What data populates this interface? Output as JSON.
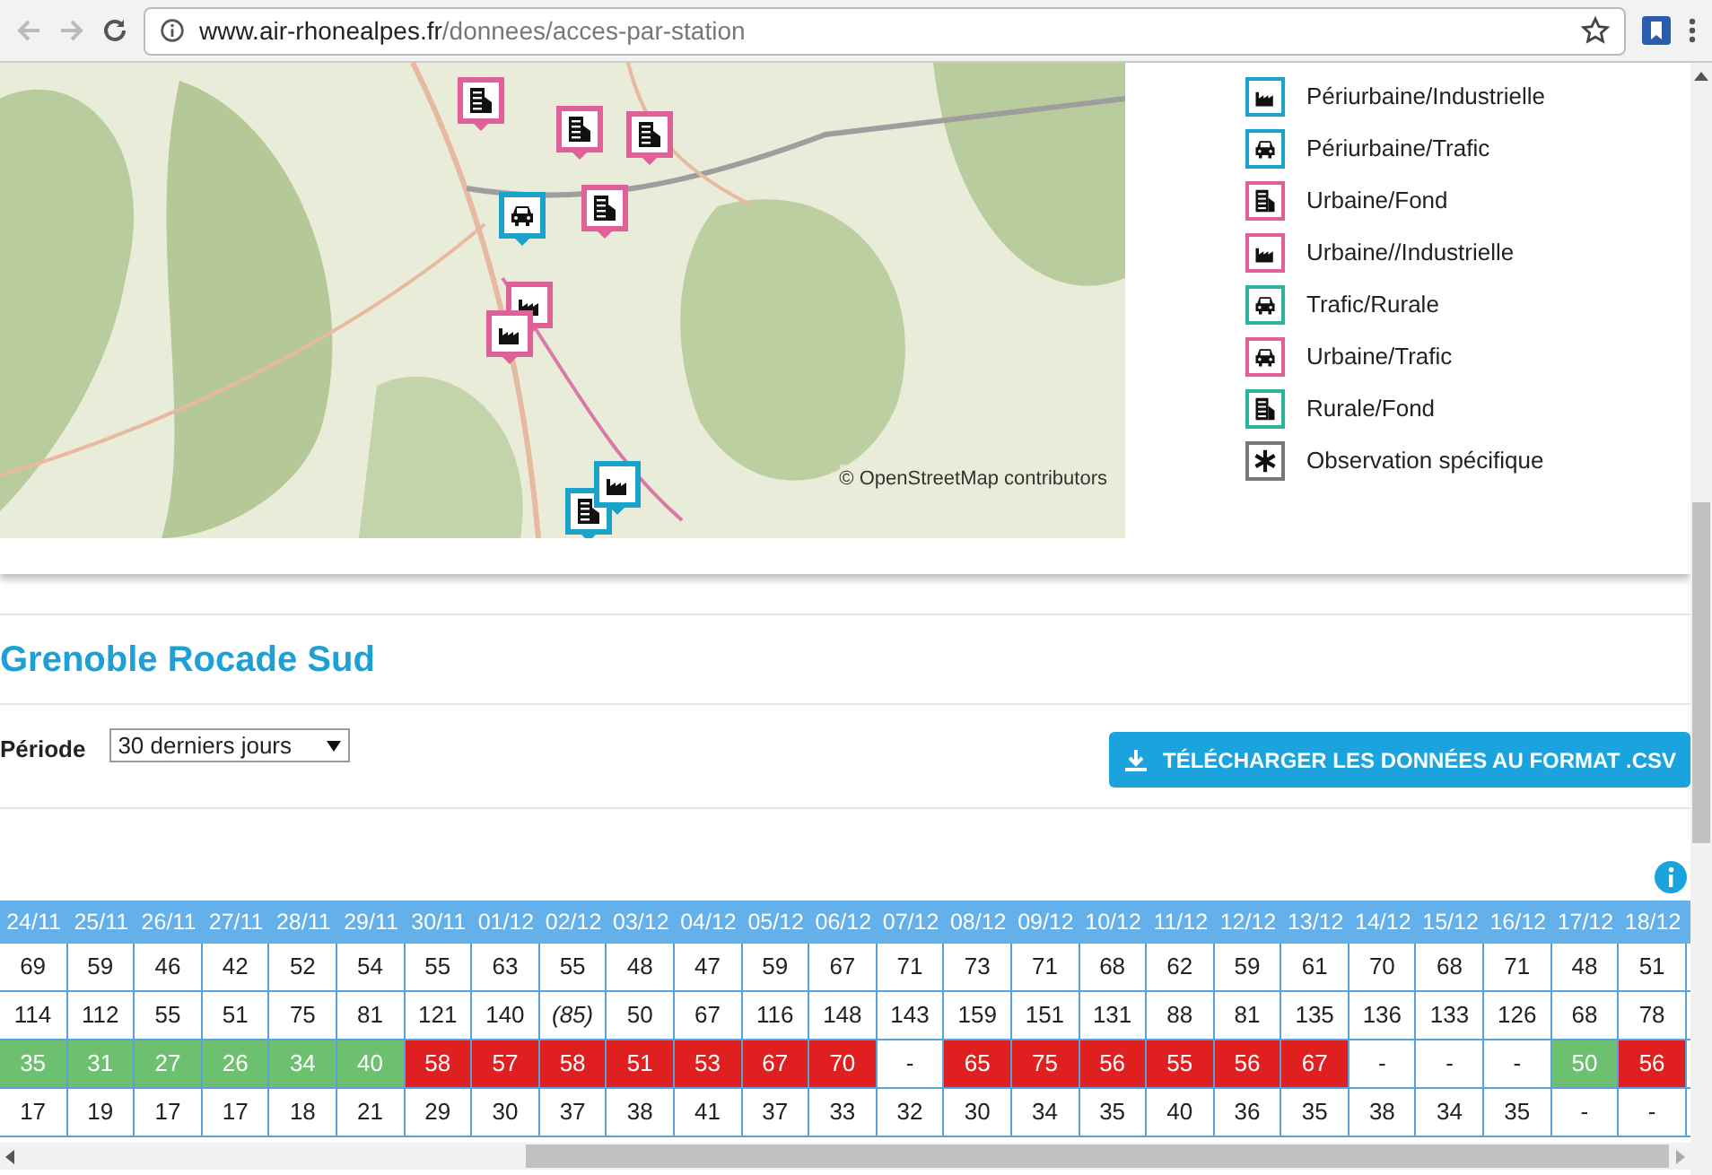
{
  "browser": {
    "url_host": "www.air-rhonealpes.fr",
    "url_path": "/donnees/acces-par-station"
  },
  "map": {
    "attribution": "© OpenStreetMap contributors",
    "markers": [
      {
        "kind": "building",
        "color": "#e0609a"
      },
      {
        "kind": "building",
        "color": "#e0609a"
      },
      {
        "kind": "building",
        "color": "#e0609a"
      },
      {
        "kind": "car",
        "color": "#1aa3c8"
      },
      {
        "kind": "building",
        "color": "#e0609a"
      },
      {
        "kind": "factory",
        "color": "#e0609a"
      },
      {
        "kind": "factory",
        "color": "#e0609a"
      },
      {
        "kind": "building",
        "color": "#1aa3c8"
      },
      {
        "kind": "factory",
        "color": "#1aa3c8"
      }
    ]
  },
  "legend": [
    {
      "kind": "factory",
      "color": "#1aa3c8",
      "label": "Périurbaine/Industrielle"
    },
    {
      "kind": "car",
      "color": "#1aa3c8",
      "label": "Périurbaine/Trafic"
    },
    {
      "kind": "building",
      "color": "#e0609a",
      "label": "Urbaine/Fond"
    },
    {
      "kind": "factory",
      "color": "#e0609a",
      "label": "Urbaine//Industrielle"
    },
    {
      "kind": "car",
      "color": "#2bb5a0",
      "label": "Trafic/Rurale"
    },
    {
      "kind": "car",
      "color": "#e0609a",
      "label": "Urbaine/Trafic"
    },
    {
      "kind": "building",
      "color": "#2bb5a0",
      "label": "Rurale/Fond"
    },
    {
      "kind": "asterisk",
      "color": "#777777",
      "label": "Observation spécifique"
    }
  ],
  "station": {
    "title": "Grenoble Rocade Sud",
    "period_label": "Période",
    "period_value": "30 derniers jours",
    "download_button": "TÉLÉCHARGER LES DONNÉES AU FORMAT .CSV"
  },
  "table": {
    "columns": [
      "24/11",
      "25/11",
      "26/11",
      "27/11",
      "28/11",
      "29/11",
      "30/11",
      "01/12",
      "02/12",
      "03/12",
      "04/12",
      "05/12",
      "06/12",
      "07/12",
      "08/12",
      "09/12",
      "10/12",
      "11/12",
      "12/12",
      "13/12",
      "14/12",
      "15/12",
      "16/12",
      "17/12",
      "18/12"
    ],
    "rows": [
      [
        "69",
        "59",
        "46",
        "42",
        "52",
        "54",
        "55",
        "63",
        "55",
        "48",
        "47",
        "59",
        "67",
        "71",
        "73",
        "71",
        "68",
        "62",
        "59",
        "61",
        "70",
        "68",
        "71",
        "48",
        "51"
      ],
      [
        "114",
        "112",
        "55",
        "51",
        "75",
        "81",
        "121",
        "140",
        {
          "text": "(85)",
          "italic": true
        },
        "50",
        "67",
        "116",
        "148",
        "143",
        "159",
        "151",
        "131",
        "88",
        "81",
        "135",
        "136",
        "133",
        "126",
        "68",
        "78"
      ],
      [
        {
          "text": "35",
          "color": "#6cc070"
        },
        {
          "text": "31",
          "color": "#6cc070"
        },
        {
          "text": "27",
          "color": "#6cc070"
        },
        {
          "text": "26",
          "color": "#6cc070"
        },
        {
          "text": "34",
          "color": "#6cc070"
        },
        {
          "text": "40",
          "color": "#6cc070"
        },
        {
          "text": "58",
          "color": "#e02020"
        },
        {
          "text": "57",
          "color": "#e02020"
        },
        {
          "text": "58",
          "color": "#e02020"
        },
        {
          "text": "51",
          "color": "#e02020"
        },
        {
          "text": "53",
          "color": "#e02020"
        },
        {
          "text": "67",
          "color": "#e02020"
        },
        {
          "text": "70",
          "color": "#e02020"
        },
        "-",
        {
          "text": "65",
          "color": "#e02020"
        },
        {
          "text": "75",
          "color": "#e02020"
        },
        {
          "text": "56",
          "color": "#e02020"
        },
        {
          "text": "55",
          "color": "#e02020"
        },
        {
          "text": "56",
          "color": "#e02020"
        },
        {
          "text": "67",
          "color": "#e02020"
        },
        "-",
        "-",
        "-",
        {
          "text": "50",
          "color": "#6cc070"
        },
        {
          "text": "56",
          "color": "#e02020"
        }
      ],
      [
        "17",
        "19",
        "17",
        "17",
        "18",
        "21",
        "29",
        "30",
        "37",
        "38",
        "41",
        "37",
        "33",
        "32",
        "30",
        "34",
        "35",
        "40",
        "36",
        "35",
        "38",
        "34",
        "35",
        "-",
        "-"
      ]
    ]
  }
}
